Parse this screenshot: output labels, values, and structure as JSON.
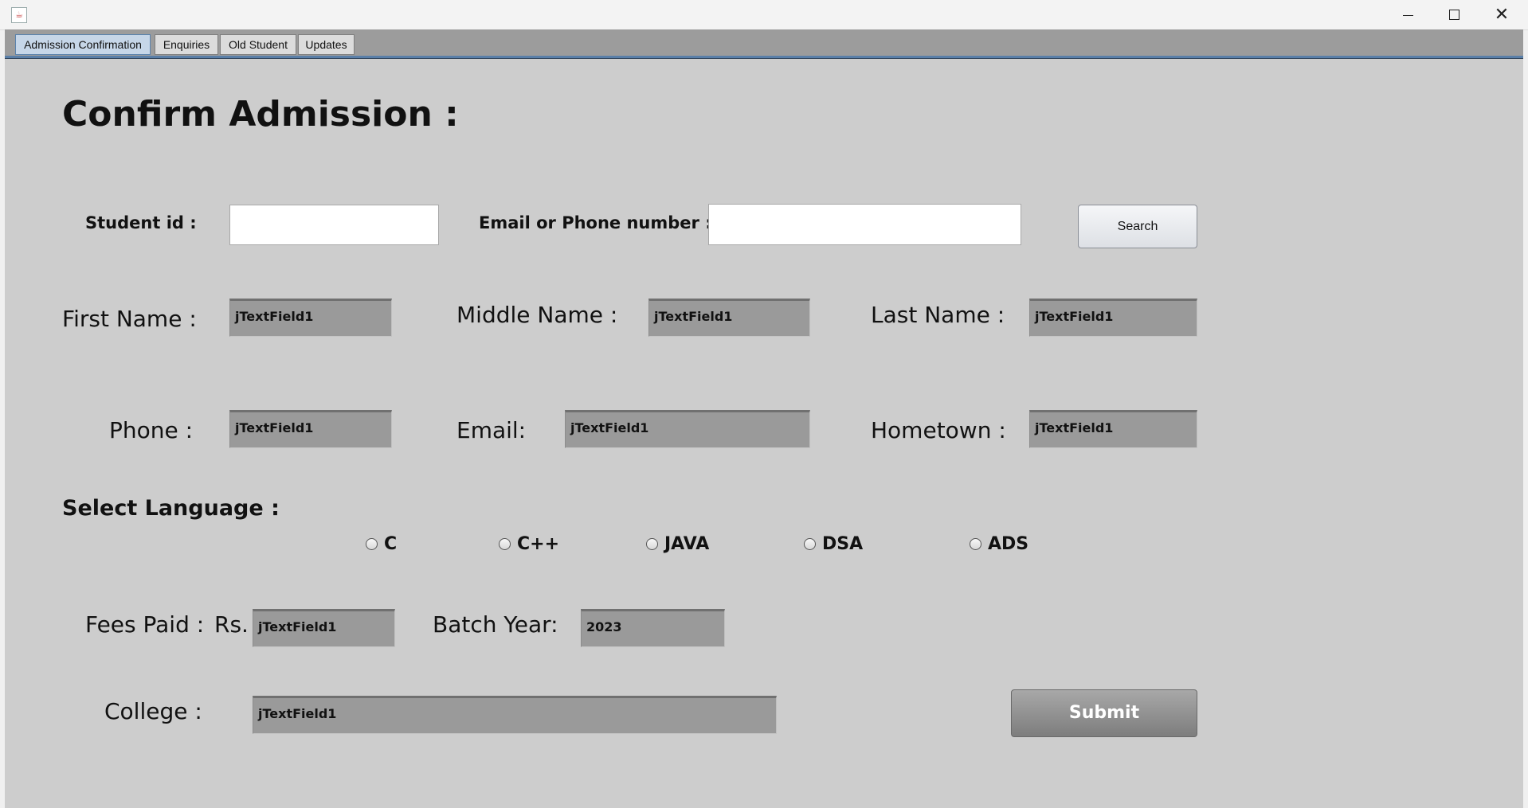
{
  "tabs": [
    {
      "label": "Admission Confirmation",
      "active": true
    },
    {
      "label": "Enquiries",
      "active": false
    },
    {
      "label": "Old Student",
      "active": false
    },
    {
      "label": "Updates",
      "active": false
    }
  ],
  "page_title": "Confirm Admission :",
  "search": {
    "student_id_label": "Student id :",
    "email_phone_label": "Email or Phone number :",
    "student_id_value": "",
    "email_phone_value": "",
    "button_label": "Search"
  },
  "fields": {
    "first_name": {
      "label": "First Name :",
      "value": "jTextField1"
    },
    "middle_name": {
      "label": "Middle Name :",
      "value": "jTextField1"
    },
    "last_name": {
      "label": "Last Name :",
      "value": "jTextField1"
    },
    "phone": {
      "label": "Phone :",
      "value": "jTextField1"
    },
    "email": {
      "label": "Email:",
      "value": "jTextField1"
    },
    "hometown": {
      "label": "Hometown :",
      "value": "jTextField1"
    },
    "fees_paid": {
      "label": "Fees Paid :",
      "currency": "Rs.",
      "value": "jTextField1"
    },
    "batch_year": {
      "label": "Batch Year:",
      "value": "2023"
    },
    "college": {
      "label": "College :",
      "value": "jTextField1"
    }
  },
  "language": {
    "label": "Select Language :",
    "options": [
      "C",
      "C++",
      "JAVA",
      "DSA",
      "ADS"
    ]
  },
  "submit_label": "Submit",
  "colors": {
    "panel_bg": "#cdcdcd",
    "tab_strip": "#9c9c9c",
    "tab_accent": "#5a7fa8",
    "field_bg": "#9a9a9a"
  }
}
